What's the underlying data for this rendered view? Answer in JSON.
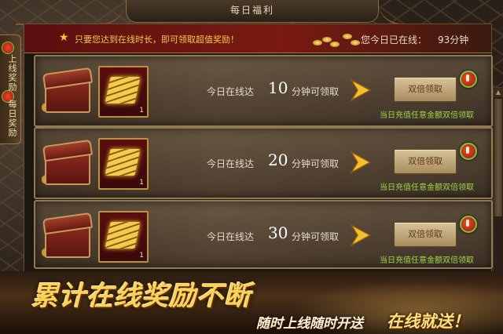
{
  "window": {
    "title": "每日福利"
  },
  "side_tab": {
    "label_1": "上线奖励",
    "label_2": "每日奖励"
  },
  "banner": {
    "text": "只要您达到在线时长，即可领取超值奖励！",
    "online_label": "您今日已在线：",
    "online_value": "93分钟"
  },
  "rewards": [
    {
      "prefix": "今日在线达",
      "minutes": "10",
      "suffix": "分钟可领取",
      "item_count": "1",
      "button_label": "双倍领取",
      "note": "当日充值任意金额双倍领取"
    },
    {
      "prefix": "今日在线达",
      "minutes": "20",
      "suffix": "分钟可领取",
      "item_count": "1",
      "button_label": "双倍领取",
      "note": "当日充值任意金额双倍领取"
    },
    {
      "prefix": "今日在线达",
      "minutes": "30",
      "suffix": "分钟可领取",
      "item_count": "1",
      "button_label": "双倍领取",
      "note": "当日充值任意金额双倍领取"
    }
  ],
  "promo": {
    "headline": "累计在线奖励不断",
    "sub1": "随时上线随时开送",
    "sub2": "在线就送！"
  },
  "colors": {
    "accent_gold": "#f2c94a",
    "note_green": "#9bd84a",
    "banner_red": "#7a1a12"
  }
}
